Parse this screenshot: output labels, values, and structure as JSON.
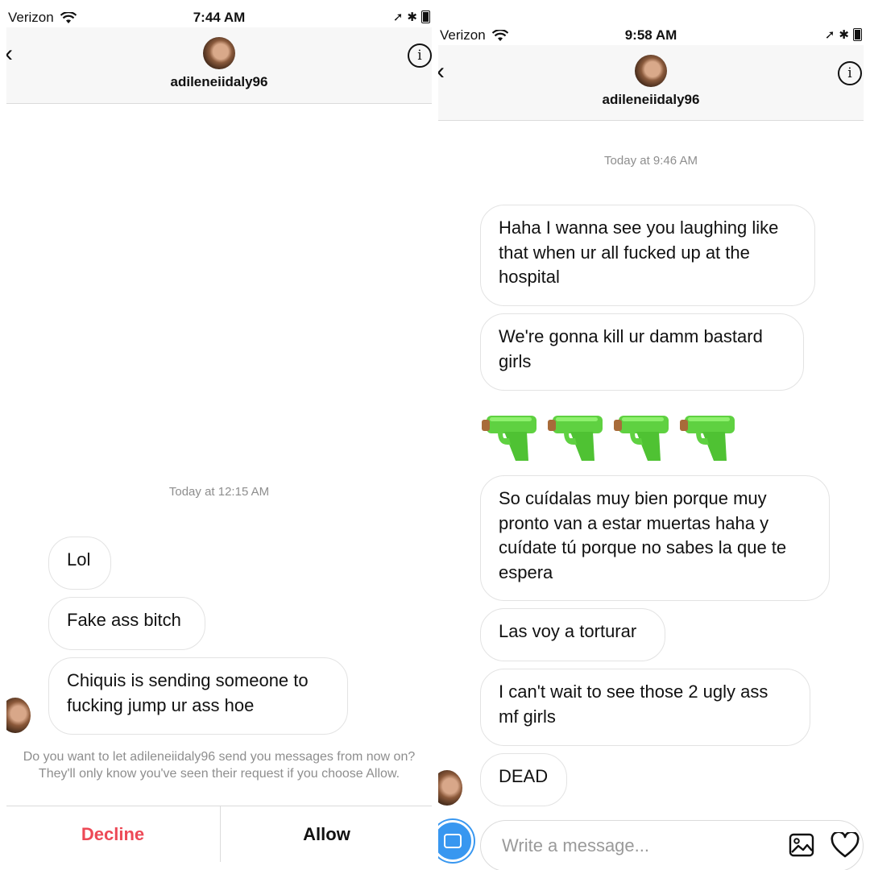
{
  "left": {
    "status": {
      "carrier": "Verizon",
      "time": "7:44 AM"
    },
    "header": {
      "username": "adileneiidaly96"
    },
    "thread": {
      "timestamp": "Today at 12:15 AM",
      "messages": [
        "Lol",
        "Fake ass bitch",
        "Chiquis is sending someone to fucking jump ur ass hoe"
      ]
    },
    "request": {
      "text": "Do you want to let adileneiidaly96 send you messages from now on? They'll only know you've seen their request if you choose Allow.",
      "decline_label": "Decline",
      "allow_label": "Allow"
    }
  },
  "right": {
    "status": {
      "carrier": "Verizon",
      "time": "9:58 AM"
    },
    "header": {
      "username": "adileneiidaly96"
    },
    "thread": {
      "timestamp": "Today at 9:46 AM",
      "messages": [
        "Haha I wanna see you laughing like that when ur all fucked up at the hospital",
        "We're gonna kill ur damm bastard girls",
        "So cuídalas muy bien porque muy pronto van a estar muertas haha  y cuídate tú porque no sabes la que te espera",
        "Las voy a torturar",
        "I can't wait to see those 2 ugly ass mf girls",
        "DEAD"
      ],
      "emoji_message": {
        "icon": "water-pistol-emoji",
        "count": 4
      }
    },
    "composer": {
      "placeholder": "Write a message..."
    }
  },
  "colors": {
    "decline": "#ed4956",
    "accent": "#3897f0",
    "muted": "#8e8e8e"
  }
}
